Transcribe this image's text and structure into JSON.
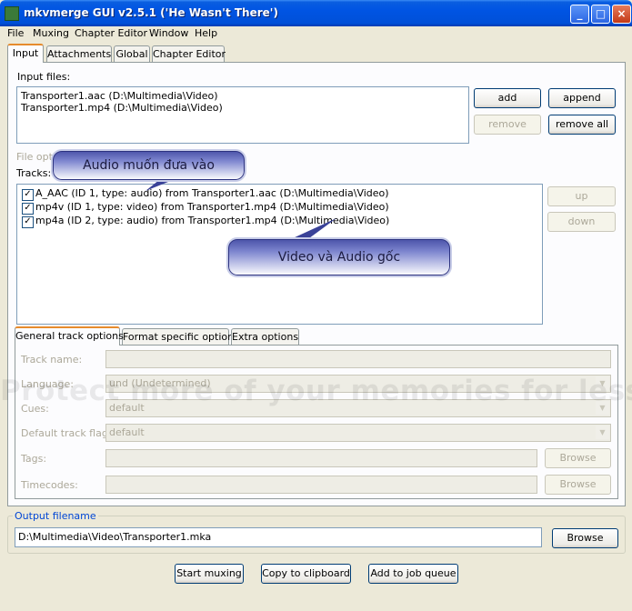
{
  "window": {
    "title": "mkvmerge GUI v2.5.1 ('He Wasn't There')",
    "controls": {
      "minimize": "_",
      "maximize": "□",
      "close": "×"
    }
  },
  "menu": [
    "File",
    "Muxing",
    "Chapter Editor",
    "Window",
    "Help"
  ],
  "tabs": [
    "Input",
    "Attachments",
    "Global",
    "Chapter Editor"
  ],
  "input": {
    "input_files_label": "Input files:",
    "files": [
      "Transporter1.aac (D:\\Multimedia\\Video)",
      "Transporter1.mp4 (D:\\Multimedia\\Video)"
    ],
    "buttons": {
      "add": "add",
      "append": "append",
      "remove": "remove",
      "remove_all": "remove all"
    },
    "file_options_label": "File options:",
    "tracks_label": "Tracks:",
    "tracks": [
      {
        "checked": true,
        "label": "A_AAC (ID 1, type: audio) from Transporter1.aac (D:\\Multimedia\\Video)"
      },
      {
        "checked": true,
        "label": "mp4v (ID 1, type: video) from Transporter1.mp4 (D:\\Multimedia\\Video)"
      },
      {
        "checked": true,
        "label": "mp4a (ID 2, type: audio) from Transporter1.mp4 (D:\\Multimedia\\Video)"
      }
    ],
    "track_buttons": {
      "up": "up",
      "down": "down"
    },
    "subtabs": [
      "General track options",
      "Format specific options",
      "Extra options"
    ],
    "options": {
      "track_name_label": "Track name:",
      "language_label": "Language:",
      "language_value": "und (Undetermined)",
      "cues_label": "Cues:",
      "cues_value": "default",
      "default_track_label": "Default track flag:",
      "default_track_value": "default",
      "tags_label": "Tags:",
      "timecodes_label": "Timecodes:",
      "browse": "Browse"
    }
  },
  "output": {
    "label": "Output filename",
    "value": "D:\\Multimedia\\Video\\Transporter1.mka",
    "browse": "Browse"
  },
  "actions": {
    "start_muxing": "Start muxing",
    "copy_to_clipboard": "Copy to clipboard",
    "add_to_job_queue": "Add to job queue"
  },
  "callouts": {
    "audio": "Audio muốn đưa vào",
    "video_audio": "Video và Audio gốc"
  },
  "watermark": "Protect more of your memories for less!",
  "colors": {
    "titlebar": "#0054e3",
    "tab_highlight": "#e68b2c",
    "window_bg": "#ece9d8",
    "callout": "#4a52a8"
  }
}
